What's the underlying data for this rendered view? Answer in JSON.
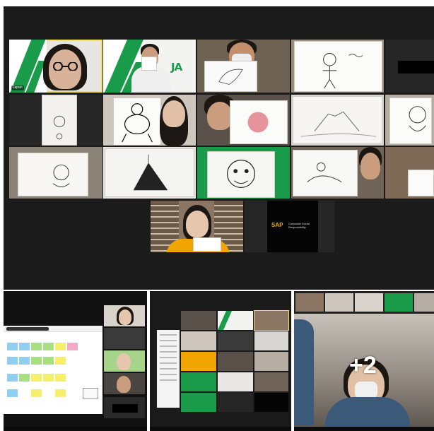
{
  "main_gallery": {
    "participant_name": "Japan",
    "sap_label": "SAP",
    "sap_sub": "Corporate Social Responsibility",
    "ja_label": "JA"
  },
  "overflow_view": {
    "extra_count": "+2"
  },
  "colors": {
    "active_speaker": "#f3e54b",
    "ja_green": "#1a9b49",
    "sap_gold": "#f0ab00"
  }
}
